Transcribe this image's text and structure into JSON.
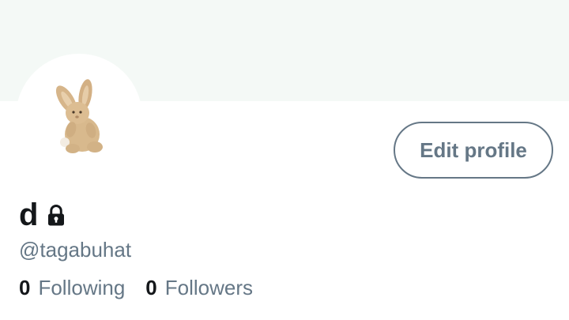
{
  "profile": {
    "display_name": "d",
    "handle": "@tagabuhat",
    "protected_icon": "lock-icon",
    "avatar_icon": "plush-bunny-avatar"
  },
  "actions": {
    "edit_profile_label": "Edit profile"
  },
  "stats": {
    "following": {
      "count": "0",
      "label": "Following"
    },
    "followers": {
      "count": "0",
      "label": "Followers"
    }
  },
  "colors": {
    "banner": "#f4f9f6",
    "secondary_text": "#657786",
    "primary_text": "#14171a"
  }
}
